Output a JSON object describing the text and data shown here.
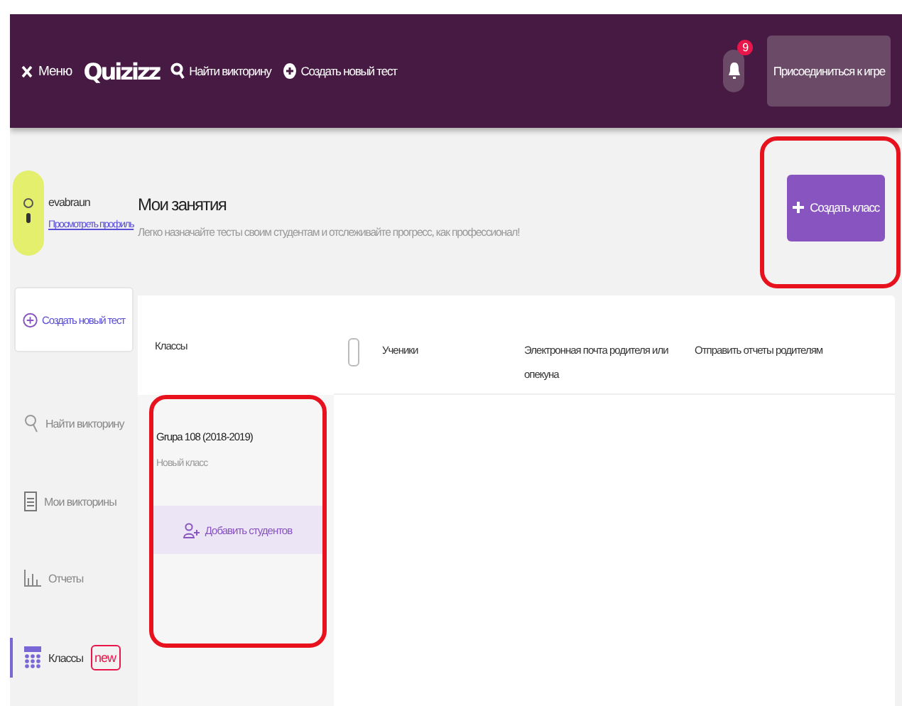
{
  "header": {
    "menu_label": "Меню",
    "logo": "Quizizz",
    "nav": [
      {
        "label": "Найти викторину",
        "kind": "search"
      },
      {
        "label": "Создать новый тест",
        "kind": "create"
      }
    ],
    "notifications": "9",
    "join_button": "Присоединиться к игре"
  },
  "sidebar": {
    "username": "evabraun",
    "profile_link": "Просмотреть профиль",
    "create_button": "Создать новый тест",
    "items": [
      {
        "label": "Найти викторину",
        "selected": false
      },
      {
        "label": "Мои викторины",
        "selected": false
      },
      {
        "label": "Отчеты",
        "selected": false
      },
      {
        "label": "Классы",
        "selected": true,
        "badge": "new"
      }
    ]
  },
  "main": {
    "title": "Мои занятия",
    "subtitle": "Легко назначайте тесты своим студентам и отслеживайте прогресс, как профессионал!",
    "create_class_button": {
      "label": "Создать класс",
      "highlighted": true
    }
  },
  "classes": {
    "heading": "Классы",
    "items": [
      {
        "name": "Grupa 108 (2018-2019)",
        "subtitle": "Новый класс",
        "add_button": "Добавить студентов",
        "highlighted": true
      }
    ]
  },
  "table": {
    "select_all_checked": false,
    "columns": [
      "Ученики",
      "Электронная почта родителя или опекуна",
      "Отправить отчеты родителям"
    ]
  }
}
